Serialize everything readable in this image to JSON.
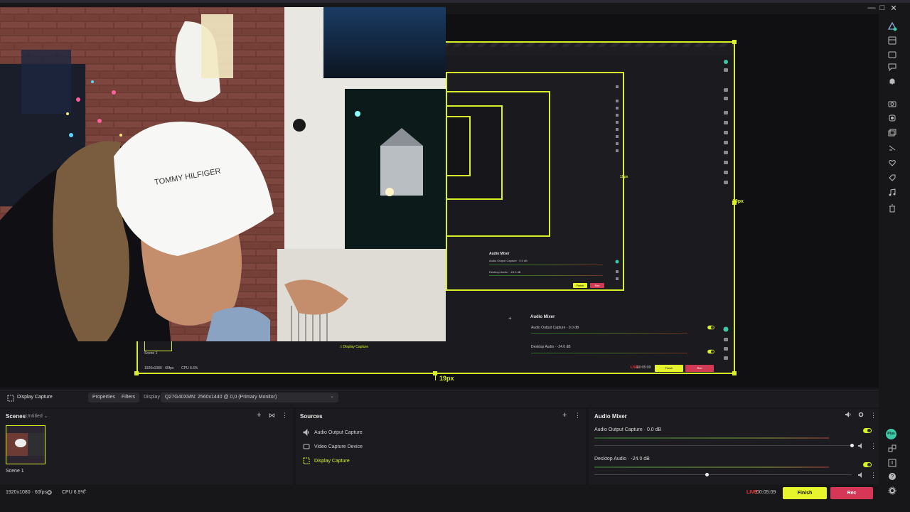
{
  "colors": {
    "accent": "#d7f02a",
    "rec": "#d63757",
    "live": "#ff3b3b",
    "bg": "#17171a"
  },
  "canvas": {
    "dim_bottom": "19px",
    "dim_right": "19px"
  },
  "preview": {
    "scene_label": "Scene 1",
    "source_label": "Display Capture",
    "mixer_title": "Audio Mixer",
    "ch1": "Audio Output Capture · 0.0 dB",
    "ch2": "Desktop Audio · -24.0 dB",
    "status_res": "1920x1080 · 60fps",
    "status_cpu": "CPU 6.6%",
    "live": "LIVE",
    "time": "00:05:09",
    "finish": "Finish",
    "rec": "Rec",
    "nested_dim": "19px"
  },
  "props": {
    "source": "Display Capture",
    "properties": "Properties",
    "filters": "Filters",
    "display_label": "Display",
    "display_value": "Q27G40XMN: 2560x1440 @ 0,0 (Primary Monitor)"
  },
  "scenes": {
    "title": "Scenes",
    "collection": "Untitled",
    "scene1": "Scene 1"
  },
  "sources": {
    "title": "Sources",
    "items": [
      "Audio Output Capture",
      "Video Capture Device",
      "Display Capture"
    ]
  },
  "mixer": {
    "title": "Audio Mixer",
    "ch1_name": "Audio Output Capture",
    "ch1_db": "0.0 dB",
    "ch2_name": "Desktop Audio",
    "ch2_db": "-24.0 dB",
    "ch1_volume": 1.0,
    "ch2_volume": 0.44
  },
  "status": {
    "resolution": "1920x1080 · 60fps",
    "cpu": "CPU 6.9%",
    "live": "LIVE",
    "time": "00:05:09",
    "finish": "Finish",
    "rec": "Rec"
  },
  "rail": {
    "badge": "Plus"
  }
}
